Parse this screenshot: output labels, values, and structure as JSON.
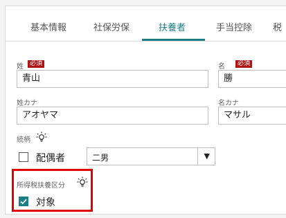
{
  "tabs": [
    {
      "label": "基本情報",
      "active": false
    },
    {
      "label": "社保労保",
      "active": false
    },
    {
      "label": "扶養者",
      "active": true
    },
    {
      "label": "手当控除",
      "active": false
    },
    {
      "label": "税",
      "active": false
    }
  ],
  "form": {
    "last_name": {
      "label": "姓",
      "required": "必須",
      "value": "青山"
    },
    "first_name": {
      "label": "名",
      "required": "必須",
      "value": "勝"
    },
    "last_name_kana": {
      "label": "姓カナ",
      "value": "アオヤマ"
    },
    "first_name_kana": {
      "label": "名カナ",
      "value": "マサル"
    },
    "relationship": {
      "label": "続柄",
      "spouse_label": "配偶者",
      "spouse_checked": false,
      "selected": "二男"
    },
    "tax_dependent": {
      "label": "所得税扶養区分",
      "check_label": "対象",
      "checked": true
    }
  },
  "colors": {
    "accent": "#1b7f86",
    "required": "#b01515",
    "highlight": "#e00000"
  }
}
